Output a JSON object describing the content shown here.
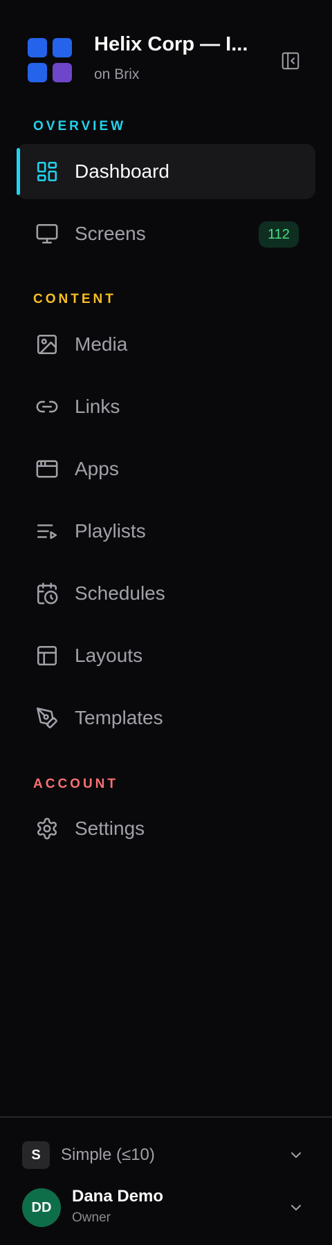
{
  "header": {
    "org_name": "Helix Corp — I...",
    "org_sub": "on Brix",
    "logo_colors": [
      "#2563eb",
      "#2563eb",
      "#2563eb",
      "#6d46c9"
    ]
  },
  "sections": [
    {
      "label": "OVERVIEW",
      "color": "#22d3ee"
    },
    {
      "label": "CONTENT",
      "color": "#fbbf24"
    },
    {
      "label": "ACCOUNT",
      "color": "#f87171"
    }
  ],
  "nav": {
    "dashboard": {
      "label": "Dashboard",
      "icon": "dashboard-grid-icon",
      "active": true
    },
    "screens": {
      "label": "Screens",
      "icon": "monitor-icon",
      "badge": "112"
    },
    "media": {
      "label": "Media",
      "icon": "image-icon"
    },
    "links": {
      "label": "Links",
      "icon": "link-icon"
    },
    "apps": {
      "label": "Apps",
      "icon": "app-window-icon"
    },
    "playlists": {
      "label": "Playlists",
      "icon": "playlist-icon"
    },
    "schedules": {
      "label": "Schedules",
      "icon": "calendar-clock-icon"
    },
    "layouts": {
      "label": "Layouts",
      "icon": "layout-icon"
    },
    "templates": {
      "label": "Templates",
      "icon": "pen-tool-icon"
    },
    "settings": {
      "label": "Settings",
      "icon": "gear-icon"
    }
  },
  "footer": {
    "plan_chip": "S",
    "plan_label": "Simple (≤10)",
    "user_initials": "DD",
    "user_name": "Dana Demo",
    "user_role": "Owner"
  },
  "colors": {
    "accent": "#22d3ee",
    "badge_bg": "#0f2e22",
    "badge_text": "#4ade80",
    "avatar_bg": "#0f6e4a"
  }
}
